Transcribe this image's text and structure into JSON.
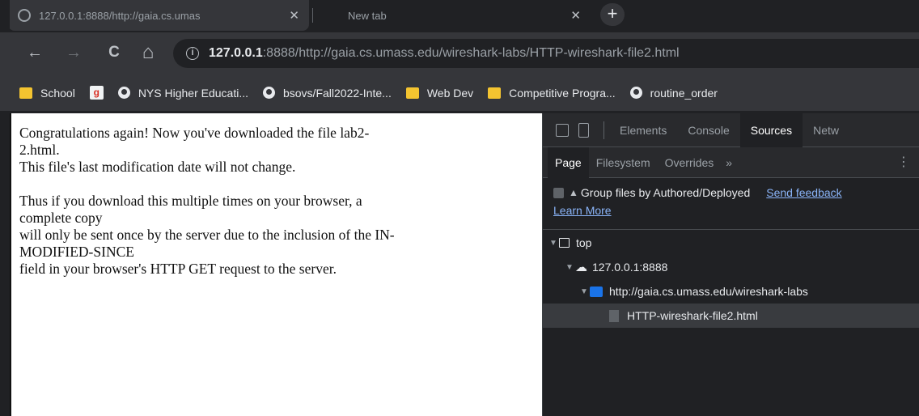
{
  "tabs": [
    {
      "title": "127.0.0.1:8888/http://gaia.cs.umas",
      "close": "✕"
    },
    {
      "title": "New tab",
      "close": "✕"
    }
  ],
  "new_tab": "+",
  "toolbar": {
    "back": "←",
    "forward": "→",
    "reload": "C",
    "home": "⌂",
    "info": "i",
    "url_host": "127.0.0.1",
    "url_rest": ":8888/http://gaia.cs.umass.edu/wireshark-labs/HTTP-wireshark-file2.html"
  },
  "bookmarks": [
    {
      "label": "School",
      "icon": "folder-icon"
    },
    {
      "label": "",
      "icon": "google-form-icon"
    },
    {
      "label": "NYS Higher Educati...",
      "icon": "globe-icon"
    },
    {
      "label": "bsovs/Fall2022-Inte...",
      "icon": "globe-icon"
    },
    {
      "label": "Web Dev",
      "icon": "folder-icon"
    },
    {
      "label": "Competitive Progra...",
      "icon": "folder-icon"
    },
    {
      "label": "routine_order",
      "icon": "globe-icon"
    }
  ],
  "page": {
    "line1": "Congratulations again! Now you've downloaded the file lab2-",
    "line2": "2.html.",
    "line3": "This file's last modification date will not change.",
    "line4": "Thus if you download this multiple times on your browser, a",
    "line5": "complete copy",
    "line6": "will only be sent once by the server due to the inclusion of the IN-",
    "line7": "MODIFIED-SINCE",
    "line8": "field in your browser's HTTP GET request to the server."
  },
  "devtools": {
    "tabs": [
      "Elements",
      "Console",
      "Sources",
      "Netw"
    ],
    "active_tab": "Sources",
    "subtabs": [
      "Page",
      "Filesystem",
      "Overrides"
    ],
    "more": "»",
    "kebab": "⋮",
    "group_label": "Group files by Authored/Deployed",
    "send_feedback": "Send feedback",
    "learn_more": "Learn More",
    "tree": {
      "top": "top",
      "host": "127.0.0.1:8888",
      "folder": "http://gaia.cs.umass.edu/wireshark-labs",
      "file": "HTTP-wireshark-file2.html"
    }
  }
}
